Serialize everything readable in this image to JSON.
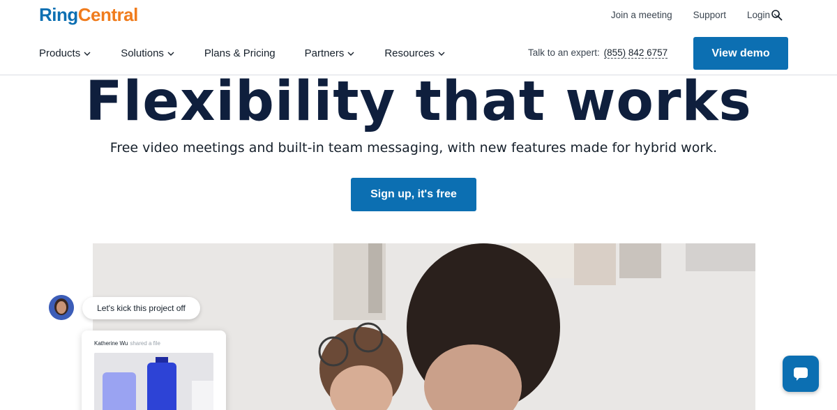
{
  "brand": {
    "ring": "Ring",
    "central": "Central"
  },
  "utility": {
    "join": "Join a meeting",
    "support": "Support",
    "login": "Login"
  },
  "nav": {
    "products": "Products",
    "solutions": "Solutions",
    "plans": "Plans & Pricing",
    "partners": "Partners",
    "resources": "Resources"
  },
  "expert": {
    "label": "Talk to an expert:",
    "phone": "(855) 842 6757"
  },
  "cta": {
    "demo": "View demo",
    "signup": "Sign up, it's free"
  },
  "hero": {
    "title": "Flexibility that works",
    "subtitle": "Free video meetings and built-in team messaging, with new features made for hybrid work."
  },
  "chat": {
    "message": "Let's kick this project off"
  },
  "file": {
    "name": "Katherine Wu",
    "action": "shared a file"
  },
  "colors": {
    "primary": "#0c6fb2",
    "brand_orange": "#f07c1d",
    "title": "#0f1f3d"
  },
  "icons": [
    "search-icon",
    "chevron-down-icon",
    "chat-icon"
  ]
}
